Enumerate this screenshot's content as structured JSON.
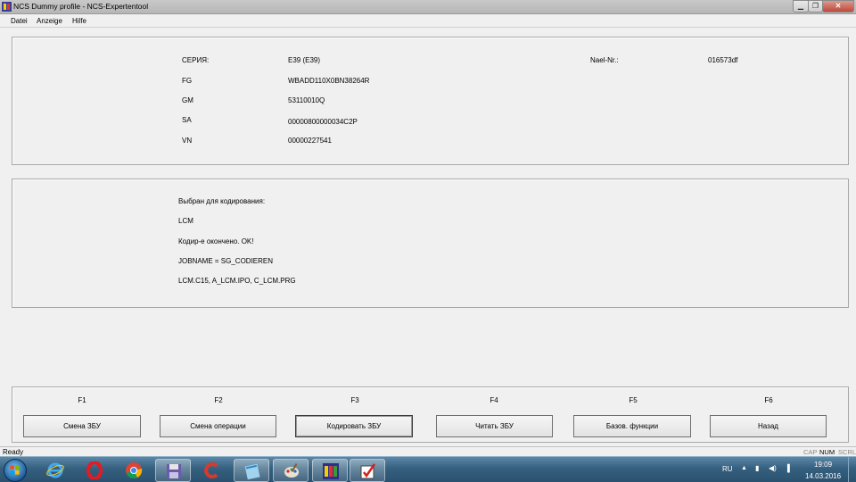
{
  "window": {
    "title": "NCS Dummy profile - NCS-Expertentool",
    "min_glyph": "▁",
    "max_glyph": "❐",
    "close_glyph": "✕"
  },
  "menu": {
    "items": [
      "Datei",
      "Anzeige",
      "Hilfe"
    ]
  },
  "vehicle": {
    "series_label": "СЕРИЯ:",
    "series_value": "E39 (E39)",
    "fg_label": "FG",
    "fg_value": "WBADD110X0BN38264R",
    "gm_label": "GM",
    "gm_value": "53110010Q",
    "sa_label": "SA",
    "sa_value": "00000800000034C2P",
    "vn_label": "VN",
    "vn_value": "00000227541",
    "nael_label": "Nael-Nr.:",
    "nael_value": "016573df"
  },
  "coding": {
    "lines": [
      "Выбран для кодирования:",
      "LCM",
      "Кодир-е окончено. OK!",
      "JOBNAME = SG_CODIEREN",
      "LCM.C15, A_LCM.IPO, C_LCM.PRG"
    ]
  },
  "function_keys": [
    {
      "key": "F1",
      "label": "Смена ЗБУ"
    },
    {
      "key": "F2",
      "label": "Смена операции"
    },
    {
      "key": "F3",
      "label": "Кодировать ЗБУ"
    },
    {
      "key": "F4",
      "label": "Читать ЗБУ"
    },
    {
      "key": "F5",
      "label": "Базов. функции"
    },
    {
      "key": "F6",
      "label": "Назад"
    }
  ],
  "status": {
    "text": "Ready",
    "cap": "CAP",
    "num": "NUM",
    "scrl": "SCRL"
  },
  "taskbar": {
    "language": "RU",
    "time": "19:09",
    "date": "14.03.2016",
    "app_icons": [
      "start-orb-icon",
      "internet-explorer-icon",
      "opera-icon",
      "chrome-icon",
      "floppy-save-icon",
      "ccleaner-icon",
      "notepad-icon",
      "paint-icon",
      "ncs-expert-icon",
      "checklist-icon"
    ]
  },
  "colors": {
    "titlebar": "#c0c0c0",
    "panel_bg": "#f0f0f0",
    "taskbar": "#35607f"
  }
}
